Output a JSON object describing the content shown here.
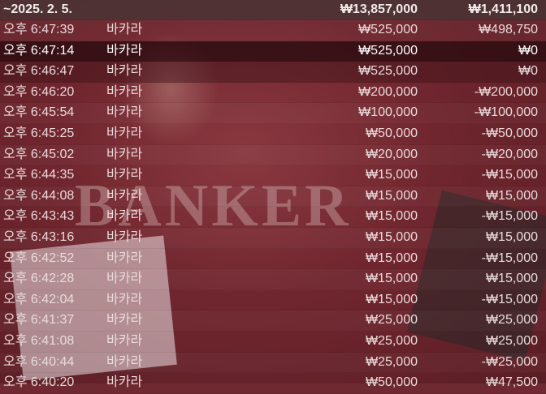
{
  "header": {
    "date": "~2025. 2. 5.",
    "bet_total": "₩13,857,000",
    "result_total": "₩1,411,100"
  },
  "rows": [
    {
      "time": "오후 6:47:39",
      "game": "바카라",
      "bet": "₩525,000",
      "result": "₩498,750"
    },
    {
      "time": "오후 6:47:14",
      "game": "바카라",
      "bet": "₩525,000",
      "result": "₩0"
    },
    {
      "time": "오후 6:46:47",
      "game": "바카라",
      "bet": "₩525,000",
      "result": "₩0"
    },
    {
      "time": "오후 6:46:20",
      "game": "바카라",
      "bet": "₩200,000",
      "result": "-₩200,000"
    },
    {
      "time": "오후 6:45:54",
      "game": "바카라",
      "bet": "₩100,000",
      "result": "-₩100,000"
    },
    {
      "time": "오후 6:45:25",
      "game": "바카라",
      "bet": "₩50,000",
      "result": "-₩50,000"
    },
    {
      "time": "오후 6:45:02",
      "game": "바카라",
      "bet": "₩20,000",
      "result": "-₩20,000"
    },
    {
      "time": "오후 6:44:35",
      "game": "바카라",
      "bet": "₩15,000",
      "result": "-₩15,000"
    },
    {
      "time": "오후 6:44:08",
      "game": "바카라",
      "bet": "₩15,000",
      "result": "₩15,000"
    },
    {
      "time": "오후 6:43:43",
      "game": "바카라",
      "bet": "₩15,000",
      "result": "-₩15,000"
    },
    {
      "time": "오후 6:43:16",
      "game": "바카라",
      "bet": "₩15,000",
      "result": "₩15,000"
    },
    {
      "time": "오후 6:42:52",
      "game": "바카라",
      "bet": "₩15,000",
      "result": "-₩15,000"
    },
    {
      "time": "오후 6:42:28",
      "game": "바카라",
      "bet": "₩15,000",
      "result": "₩15,000"
    },
    {
      "time": "오후 6:42:04",
      "game": "바카라",
      "bet": "₩15,000",
      "result": "-₩15,000"
    },
    {
      "time": "오후 6:41:37",
      "game": "바카라",
      "bet": "₩25,000",
      "result": "₩25,000"
    },
    {
      "time": "오후 6:41:08",
      "game": "바카라",
      "bet": "₩25,000",
      "result": "₩25,000"
    },
    {
      "time": "오후 6:40:44",
      "game": "바카라",
      "bet": "₩25,000",
      "result": "-₩25,000"
    },
    {
      "time": "오후 6:40:20",
      "game": "바카라",
      "bet": "₩50,000",
      "result": "₩47,500"
    }
  ],
  "background": {
    "table_label": "BANKER",
    "felt_color": "#6e2a30"
  }
}
